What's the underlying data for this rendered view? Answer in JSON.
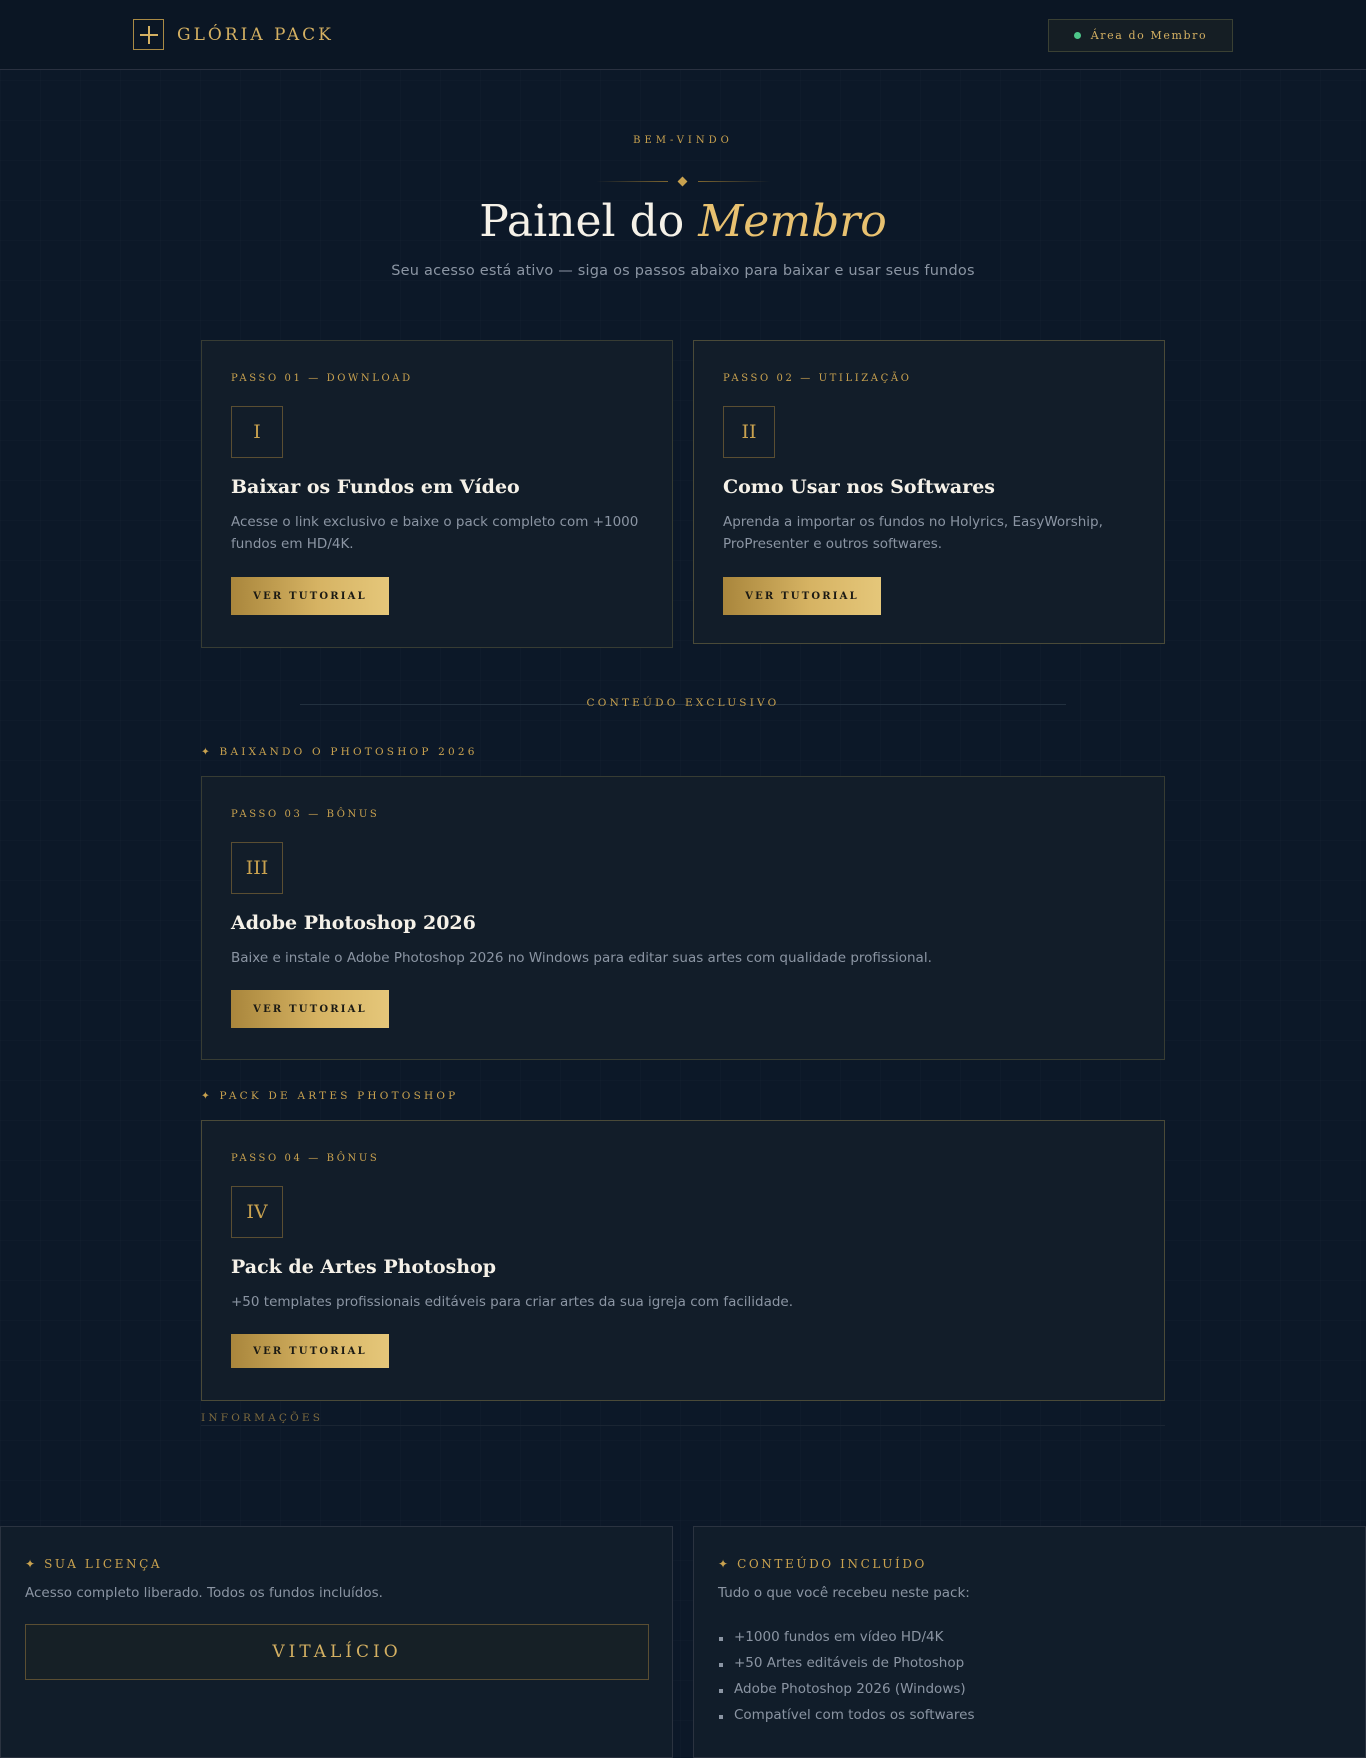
{
  "header": {
    "logo_text": "GLÓRIA PACK",
    "member_button": "Área do Membro"
  },
  "hero": {
    "eyebrow": "BEM-VINDO",
    "title_prefix": "Painel do",
    "title_accent": "Membro",
    "subtitle": "Seu acesso está ativo — siga os passos abaixo para baixar e usar seus fundos"
  },
  "steps": [
    {
      "step_label": "PASSO 01 — DOWNLOAD",
      "numeral": "I",
      "title": "Baixar os Fundos em Vídeo",
      "description_line1": "Acesse o link exclusivo e baixe o pack completo com +1000",
      "description_line2": "fundos em HD/4K.",
      "button": "VER TUTORIAL"
    },
    {
      "step_label": "PASSO 02 — UTILIZAÇÃO",
      "numeral": "II",
      "title": "Como Usar nos Softwares",
      "description_line1": "Aprenda a importar os fundos no Holyrics, EasyWorship,",
      "description_line2": "ProPresenter e outros softwares.",
      "button": "VER TUTORIAL"
    },
    {
      "step_label": "PASSO 03 — BÔNUS",
      "numeral": "III",
      "title": "Adobe Photoshop 2026",
      "description": "Baixe e instale o Adobe Photoshop 2026 no Windows para editar suas artes com qualidade profissional.",
      "button": "VER TUTORIAL"
    },
    {
      "step_label": "PASSO 04 — BÔNUS",
      "numeral": "IV",
      "title": "Pack de Artes Photoshop",
      "description": "+50 templates profissionais editáveis para criar artes da sua igreja com facilidade.",
      "button": "VER TUTORIAL"
    }
  ],
  "exclusive": {
    "heading": "CONTEÚDO EXCLUSIVO",
    "section_photoshop": "✦ BAIXANDO O PHOTOSHOP 2026",
    "section_pack": "✦ PACK DE ARTES PHOTOSHOP"
  },
  "info": {
    "heading": "INFORMAÇÕES"
  },
  "license": {
    "title": "✦ SUA LICENÇA",
    "description": "Acesso completo liberado. Todos os fundos incluídos.",
    "badge": "VITALÍCIO"
  },
  "included": {
    "title": "✦ CONTEÚDO INCLUÍDO",
    "description": "Tudo o que você recebeu neste pack:",
    "items": [
      "+1000 fundos em vídeo HD/4K",
      "+50 Artes editáveis de Photoshop",
      "Adobe Photoshop 2026 (Windows)",
      "Compatível com todos os softwares"
    ]
  }
}
